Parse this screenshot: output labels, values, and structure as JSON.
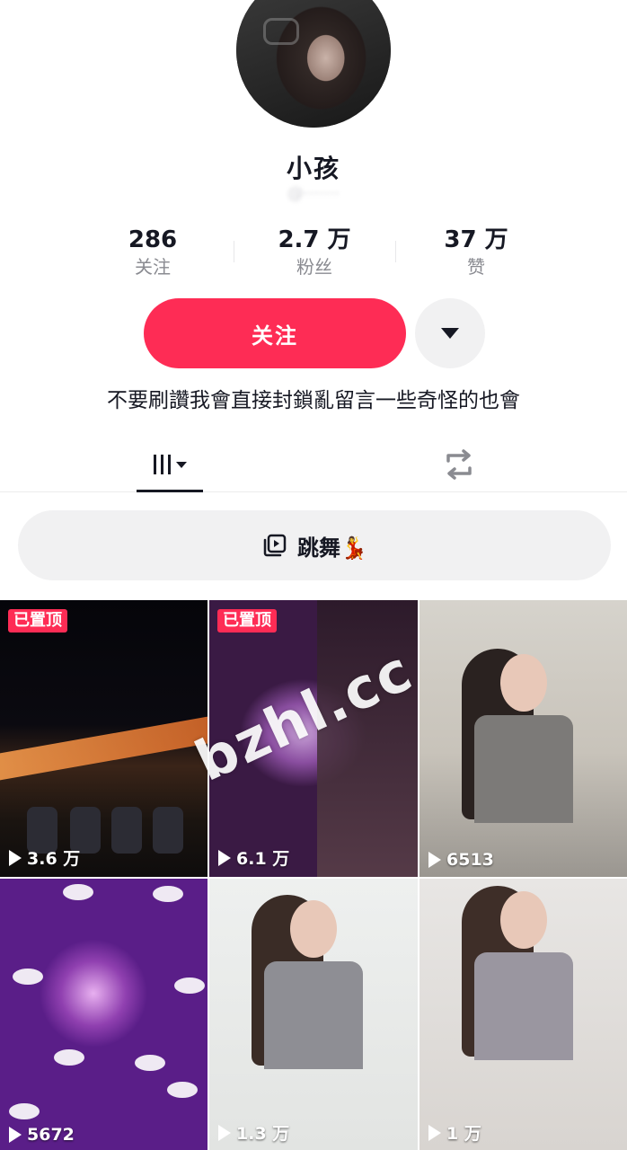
{
  "profile": {
    "username": "小孩",
    "handle": "@·······",
    "bio": "不要刷讚我會直接封鎖亂留言一些奇怪的也會"
  },
  "stats": [
    {
      "value": "286",
      "label": "关注"
    },
    {
      "value": "2.7 万",
      "label": "粉丝"
    },
    {
      "value": "37 万",
      "label": "赞"
    }
  ],
  "actions": {
    "follow_label": "关注"
  },
  "tabs": {
    "grid_icon": "grid-bars-icon",
    "repost_icon": "repost-icon"
  },
  "playlist": {
    "label": "跳舞💃",
    "icon": "playlist-icon"
  },
  "videos": [
    {
      "views": "3.6 万",
      "pinned": "已置顶"
    },
    {
      "views": "6.1 万",
      "pinned": "已置顶"
    },
    {
      "views": "6513"
    },
    {
      "views": "5672"
    },
    {
      "views": "1.3 万"
    },
    {
      "views": "1 万"
    }
  ],
  "watermark": "bzhl.cc",
  "colors": {
    "accent": "#fe2c55",
    "text": "#161823",
    "muted": "#8a8b91",
    "button_bg": "#f1f1f2"
  }
}
